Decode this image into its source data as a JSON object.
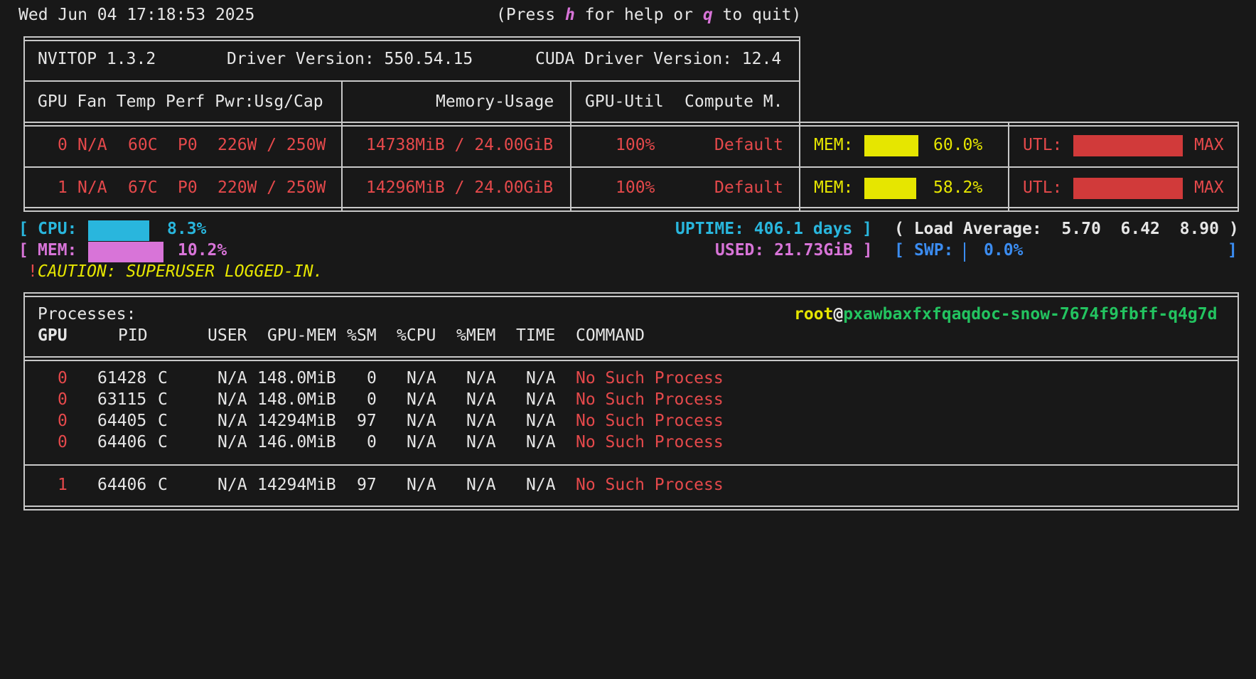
{
  "header": {
    "datetime": "Wed Jun 04 17:18:53 2025",
    "help_prefix": "(Press ",
    "help_key": "h",
    "help_mid": " for help or ",
    "quit_key": "q",
    "help_suffix": " to quit)"
  },
  "info": {
    "app_version": "NVITOP 1.3.2",
    "driver": "Driver Version: 550.54.15",
    "cuda": "CUDA Driver Version: 12.4"
  },
  "gpu_headers": {
    "gpu": "GPU Fan Temp Perf Pwr:Usg/Cap",
    "memory": "Memory-Usage",
    "util": "GPU-Util",
    "compute": "Compute M."
  },
  "gpus": [
    {
      "id": "0",
      "fan": "N/A",
      "temp": "60C",
      "perf": "P0",
      "power": "226W / 250W",
      "memory": "14738MiB / 24.00GiB",
      "util": "100%",
      "compute": "Default",
      "mem_label": "MEM:",
      "mem_pct": "60.0%",
      "mem_fraction": 0.6,
      "utl_label": "UTL:",
      "utl_value": "MAX",
      "utl_fraction": 1.0
    },
    {
      "id": "1",
      "fan": "N/A",
      "temp": "67C",
      "perf": "P0",
      "power": "220W / 250W",
      "memory": "14296MiB / 24.00GiB",
      "util": "100%",
      "compute": "Default",
      "mem_label": "MEM:",
      "mem_pct": "58.2%",
      "mem_fraction": 0.582,
      "utl_label": "UTL:",
      "utl_value": "MAX",
      "utl_fraction": 1.0
    }
  ],
  "host": {
    "cpu_label": "CPU:",
    "cpu_pct": "8.3%",
    "cpu_fraction": 0.083,
    "mem_label": "MEM:",
    "mem_pct": "10.2%",
    "mem_fraction": 0.102,
    "uptime_label": "UPTIME:",
    "uptime_value": "406.1 days",
    "used_label": "USED:",
    "used_value": "21.73GiB",
    "load_label": "( Load Average:",
    "load_1": "5.70",
    "load_5": "6.42",
    "load_15": "8.90",
    "load_close": ")",
    "swp_label": "SWP:",
    "swp_pct": "0.0%",
    "caution_mark": "!",
    "caution_text": "CAUTION: SUPERUSER LOGGED-IN."
  },
  "processes": {
    "title": "Processes:",
    "user": "root",
    "at": "@",
    "hostname": "pxawbaxfxfqaqdoc-snow-7674f9fbff-q4g7d",
    "columns": {
      "gpu": "GPU",
      "pid": "PID",
      "user": "USER",
      "gpu_mem": "GPU-MEM",
      "sm": "%SM",
      "cpu": "%CPU",
      "mem": "%MEM",
      "time": "TIME",
      "command": "COMMAND"
    },
    "rows": [
      {
        "gpu": "0",
        "pid": "61428",
        "type": "C",
        "user": "N/A",
        "gpu_mem": "148.0MiB",
        "sm": "0",
        "cpu": "N/A",
        "mem": "N/A",
        "time": "N/A",
        "command": "No Such Process"
      },
      {
        "gpu": "0",
        "pid": "63115",
        "type": "C",
        "user": "N/A",
        "gpu_mem": "148.0MiB",
        "sm": "0",
        "cpu": "N/A",
        "mem": "N/A",
        "time": "N/A",
        "command": "No Such Process"
      },
      {
        "gpu": "0",
        "pid": "64405",
        "type": "C",
        "user": "N/A",
        "gpu_mem": "14294MiB",
        "sm": "97",
        "cpu": "N/A",
        "mem": "N/A",
        "time": "N/A",
        "command": "No Such Process"
      },
      {
        "gpu": "0",
        "pid": "64406",
        "type": "C",
        "user": "N/A",
        "gpu_mem": "146.0MiB",
        "sm": "0",
        "cpu": "N/A",
        "mem": "N/A",
        "time": "N/A",
        "command": "No Such Process"
      },
      {
        "gpu": "1",
        "pid": "64406",
        "type": "C",
        "user": "N/A",
        "gpu_mem": "14294MiB",
        "sm": "97",
        "cpu": "N/A",
        "mem": "N/A",
        "time": "N/A",
        "command": "No Such Process"
      }
    ]
  },
  "colors": {
    "background": "#181818",
    "red": "#e5494b",
    "yellow": "#e6e600",
    "cyan": "#29b6dd",
    "magenta": "#d874d8",
    "blue": "#3b8cf0",
    "green": "#23c460",
    "mem_bar": "#e6e600",
    "utl_bar": "#d13a3a",
    "cpu_bar": "#29b6dd",
    "host_mem_bar": "#d874d8"
  }
}
